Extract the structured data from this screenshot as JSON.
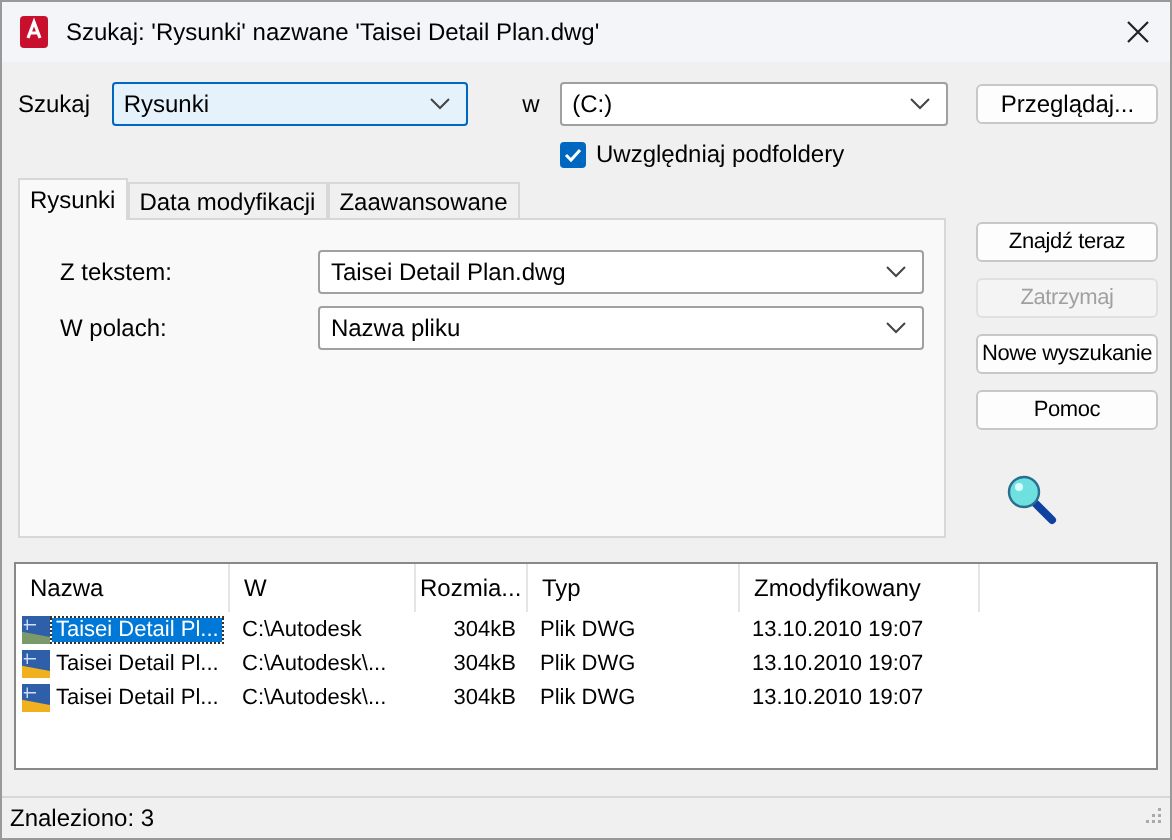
{
  "window": {
    "title": "Szukaj: 'Rysunki' nazwane 'Taisei Detail Plan.dwg'"
  },
  "search": {
    "label": "Szukaj",
    "value": "Rysunki",
    "focused": true
  },
  "location": {
    "label": "w",
    "value": "(C:)"
  },
  "browse_button": "Przeglądaj...",
  "subfolders": {
    "label": "Uwzględniaj podfoldery",
    "checked": true
  },
  "tabs": [
    {
      "label": "Rysunki",
      "selected": true
    },
    {
      "label": "Data modyfikacji",
      "selected": false
    },
    {
      "label": "Zaawansowane",
      "selected": false
    }
  ],
  "fields": [
    {
      "label": "Z tekstem:",
      "value": "Taisei Detail Plan.dwg"
    },
    {
      "label": "W polach:",
      "value": "Nazwa pliku"
    }
  ],
  "buttons": [
    {
      "label": "Znajdź teraz",
      "disabled": false
    },
    {
      "label": "Zatrzymaj",
      "disabled": true
    },
    {
      "label": "Nowe wyszukanie",
      "disabled": false
    },
    {
      "label": "Pomoc",
      "disabled": false
    }
  ],
  "table": {
    "columns": [
      "Nazwa",
      "W",
      "Rozmia...",
      "Typ",
      "Zmodyfikowany"
    ],
    "rows": [
      {
        "cells": [
          "Taisei Detail Pl...",
          "C:\\Autodesk",
          "304kB",
          "Plik DWG",
          "13.10.2010 19:07"
        ],
        "selected": true
      },
      {
        "cells": [
          "Taisei Detail Pl...",
          "C:\\Autodesk\\...",
          "304kB",
          "Plik DWG",
          "13.10.2010 19:07"
        ],
        "selected": false
      },
      {
        "cells": [
          "Taisei Detail Pl...",
          "C:\\Autodesk\\...",
          "304kB",
          "Plik DWG",
          "13.10.2010 19:07"
        ],
        "selected": false
      }
    ]
  },
  "status_bar": "Znaleziono: 3"
}
